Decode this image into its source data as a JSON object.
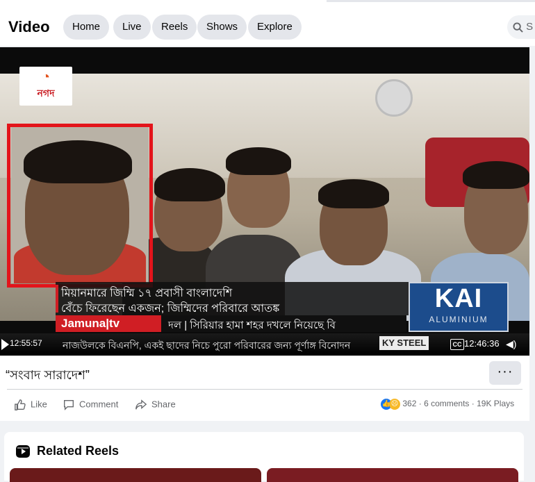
{
  "header": {
    "title": "Video",
    "tabs": [
      {
        "label": "Home"
      },
      {
        "label": "Live"
      },
      {
        "label": "Reels"
      },
      {
        "label": "Shows"
      },
      {
        "label": "Explore"
      }
    ],
    "search_label": "S"
  },
  "video": {
    "channel_logo_text": "নগদ",
    "caption_line1": "মিয়ানমারে জিম্মি ১৭ প্রবাসী বাংলাদেশি",
    "caption_line2": "বেঁচে ফিরেছেন একজন; জিম্মিদের পরিবারে আতঙ্ক",
    "jamuna_label": "Jamuna|tv",
    "ticker_main": "দল  |  সিরিয়ার হামা শহর দখলে নিয়েছে বি",
    "ticker_bottom": "নাজউলকে বিএনপি, একই ছাদের নিচে পুরো পরিবারের জন্য পূর্ণাঙ্গ বিনোদন",
    "sponsor_big": "KAI",
    "sponsor_small": "ALUMINIUM",
    "sponsor2": "KY STEEL",
    "timecode": "12:55:57",
    "cc_label": "CC",
    "duration": "12:46:36"
  },
  "post": {
    "title": "“সংবাদ সারাদেশ”",
    "more_label": "···",
    "actions": {
      "like": "Like",
      "comment": "Comment",
      "share": "Share"
    },
    "reaction_count": "362",
    "comments": "6 comments",
    "plays": "19K Plays"
  },
  "related": {
    "title": "Related Reels"
  },
  "colors": {
    "accent_blue": "#1877f2",
    "highlight_red": "#e3141b",
    "jamuna_red": "#d01e24"
  }
}
